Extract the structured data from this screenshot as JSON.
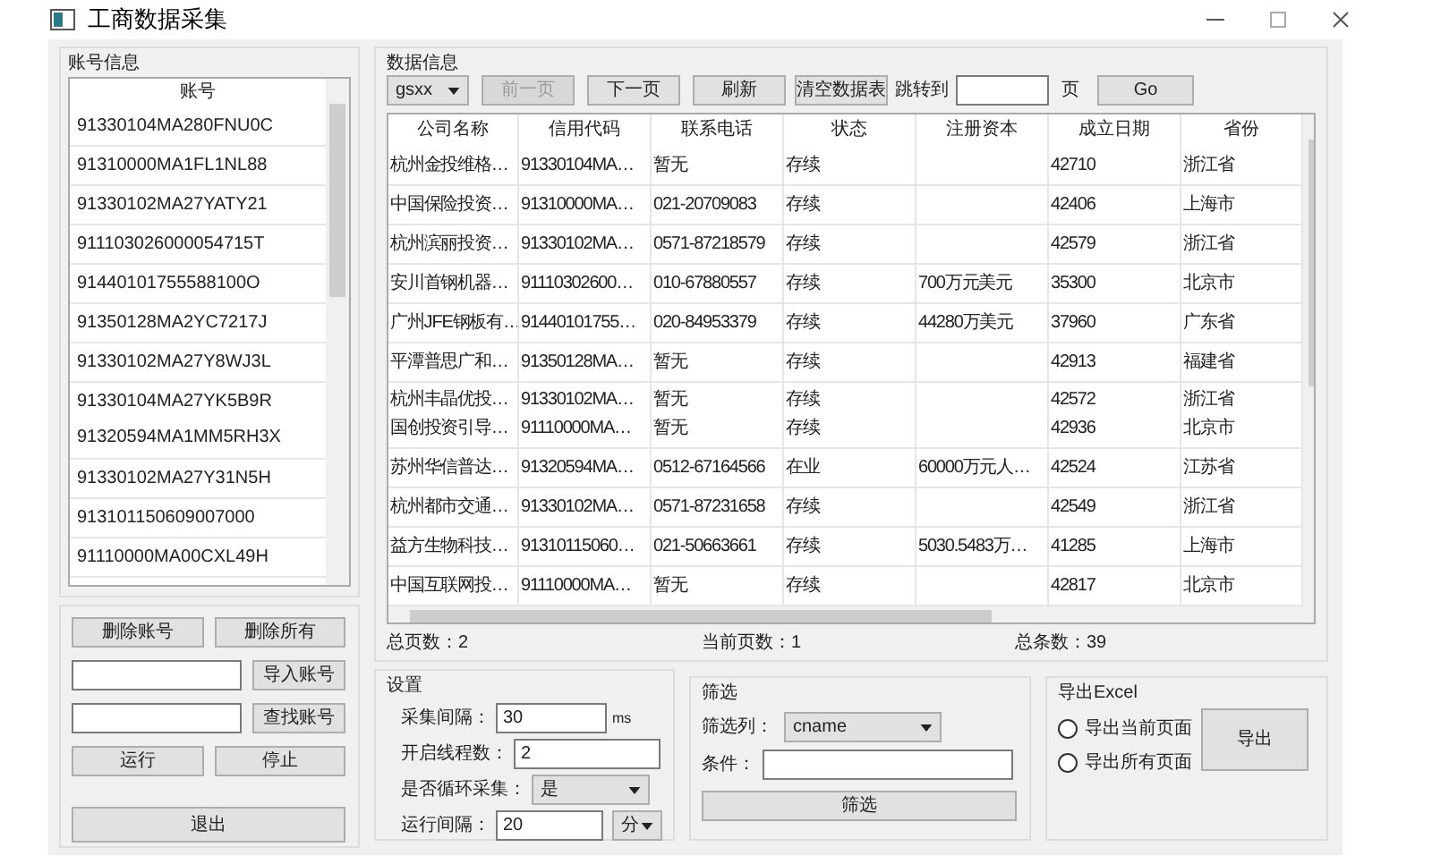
{
  "window": {
    "title": "工商数据采集"
  },
  "accounts": {
    "title": "账号信息",
    "header": "账号",
    "items": [
      {
        "lines": [
          "91330104MA280FNU0C"
        ]
      },
      {
        "lines": [
          "91310000MA1FL1NL88"
        ]
      },
      {
        "lines": [
          "91330102MA27YATY21"
        ]
      },
      {
        "lines": [
          "911103026000054715T"
        ]
      },
      {
        "lines": [
          "91440101755588100O"
        ]
      },
      {
        "lines": [
          "91350128MA2YC7217J"
        ]
      },
      {
        "lines": [
          "91330102MA27Y8WJ3L"
        ]
      },
      {
        "lines": [
          "91330104MA27YK5B9R",
          "91320594MA1MM5RH3X"
        ]
      },
      {
        "lines": [
          "91330102MA27Y31N5H"
        ]
      },
      {
        "lines": [
          "913101150609007000"
        ]
      },
      {
        "lines": [
          "91110000MA00CXL49H"
        ]
      }
    ]
  },
  "account_actions": {
    "delete": "删除账号",
    "delete_all": "删除所有",
    "import": "导入账号",
    "find": "查找账号",
    "run": "运行",
    "stop": "停止",
    "exit": "退出"
  },
  "data": {
    "title": "数据信息",
    "table_select": "gsxx",
    "prev": {
      "label": "前一页",
      "disabled": true
    },
    "next": {
      "label": "下一页",
      "disabled": false
    },
    "refresh": "刷新",
    "clear": "清空数据表",
    "jump_label": "跳转到",
    "page_unit": "页",
    "go": "Go",
    "columns": [
      "公司名称",
      "信用代码",
      "联系电话",
      "状态",
      "注册资本",
      "成立日期",
      "省份"
    ],
    "rows": [
      {
        "lines": [
          {
            "company": "杭州金投维格…",
            "credit_code": "91330104MA…",
            "phone": "暂无",
            "status": "存续",
            "founded": "42710",
            "province": "浙江省"
          }
        ]
      },
      {
        "lines": [
          {
            "company": "中国保险投资…",
            "credit_code": "91310000MA…",
            "phone": "021-20709083",
            "status": "存续",
            "founded": "42406",
            "province": "上海市"
          }
        ]
      },
      {
        "lines": [
          {
            "company": "杭州滨丽投资…",
            "credit_code": "91330102MA…",
            "phone": "0571-87218579",
            "status": "存续",
            "founded": "42579",
            "province": "浙江省"
          }
        ]
      },
      {
        "lines": [
          {
            "company": "安川首钢机器…",
            "credit_code": "91110302600…",
            "phone": "010-67880557",
            "status": "存续",
            "capital": "700万元美元",
            "founded": "35300",
            "province": "北京市"
          }
        ]
      },
      {
        "lines": [
          {
            "company": "广州JFE钢板有…",
            "credit_code": "91440101755…",
            "phone": "020-84953379",
            "status": "存续",
            "capital": "44280万美元",
            "founded": "37960",
            "province": "广东省"
          }
        ]
      },
      {
        "lines": [
          {
            "company": "平潭普思广和…",
            "credit_code": "91350128MA…",
            "phone": "暂无",
            "status": "存续",
            "founded": "42913",
            "province": "福建省"
          }
        ]
      },
      {
        "lines": [
          {
            "company": "杭州丰晶优投…",
            "credit_code": "91330102MA…",
            "phone": "暂无",
            "status": "存续",
            "founded": "42572",
            "province": "浙江省"
          },
          {
            "company": "国创投资引导…",
            "credit_code": "91110000MA…",
            "phone": "暂无",
            "status": "存续",
            "founded": "42936",
            "province": "北京市"
          }
        ]
      },
      {
        "lines": [
          {
            "company": "苏州华信普达…",
            "credit_code": "91320594MA…",
            "phone": "0512-67164566",
            "status": "在业",
            "capital": "60000万元人…",
            "founded": "42524",
            "province": "江苏省"
          }
        ]
      },
      {
        "lines": [
          {
            "company": "杭州都市交通…",
            "credit_code": "91330102MA…",
            "phone": "0571-87231658",
            "status": "存续",
            "founded": "42549",
            "province": "浙江省"
          }
        ]
      },
      {
        "lines": [
          {
            "company": "益方生物科技…",
            "credit_code": "91310115060…",
            "phone": "021-50663661",
            "status": "存续",
            "capital": "5030.5483万…",
            "founded": "41285",
            "province": "上海市"
          }
        ]
      },
      {
        "lines": [
          {
            "company": "中国互联网投…",
            "credit_code": "91110000MA…",
            "phone": "暂无",
            "status": "存续",
            "founded": "42817",
            "province": "北京市"
          }
        ]
      }
    ],
    "total_pages": "总页数：2",
    "current_page": "当前页数：1",
    "total_records": "总条数：39"
  },
  "settings": {
    "title": "设置",
    "interval_label": "采集间隔：",
    "interval": "30",
    "interval_unit": "ms",
    "threads_label": "开启线程数：",
    "threads": "2",
    "loop_label": "是否循环采集：",
    "loop": "是",
    "run_interval_label": "运行间隔：",
    "run_interval": "20",
    "run_interval_unit": "分"
  },
  "filter": {
    "title": "筛选",
    "column_label": "筛选列：",
    "column": "cname",
    "condition_label": "条件：",
    "button": "筛选"
  },
  "export": {
    "title": "导出Excel",
    "options": [
      {
        "label": "导出当前页面",
        "selected": false
      },
      {
        "label": "导出所有页面",
        "selected": false
      }
    ],
    "button": "导出"
  }
}
